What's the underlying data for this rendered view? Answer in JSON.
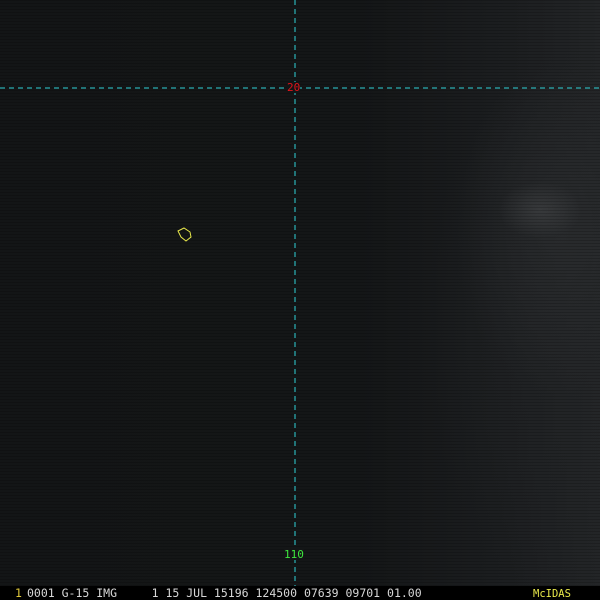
{
  "colors": {
    "grid_line": "#2fd3d8",
    "latitude_label": "#e0141a",
    "longitude_label": "#3ee63e",
    "map_outline": "#e8e84a",
    "status_text": "#d7d7d7",
    "frame_number": "#e0c83a",
    "brand": "#e8e84a"
  },
  "grid": {
    "latitude_label": "20",
    "longitude_label": "110"
  },
  "status_bar": {
    "frame_number": "1",
    "text": "0001 G-15 IMG     1 15 JUL 15196 124500 07639 09701 01.00",
    "brand": "McIDAS"
  },
  "icons": {
    "island_outline": "island-outline-icon"
  }
}
